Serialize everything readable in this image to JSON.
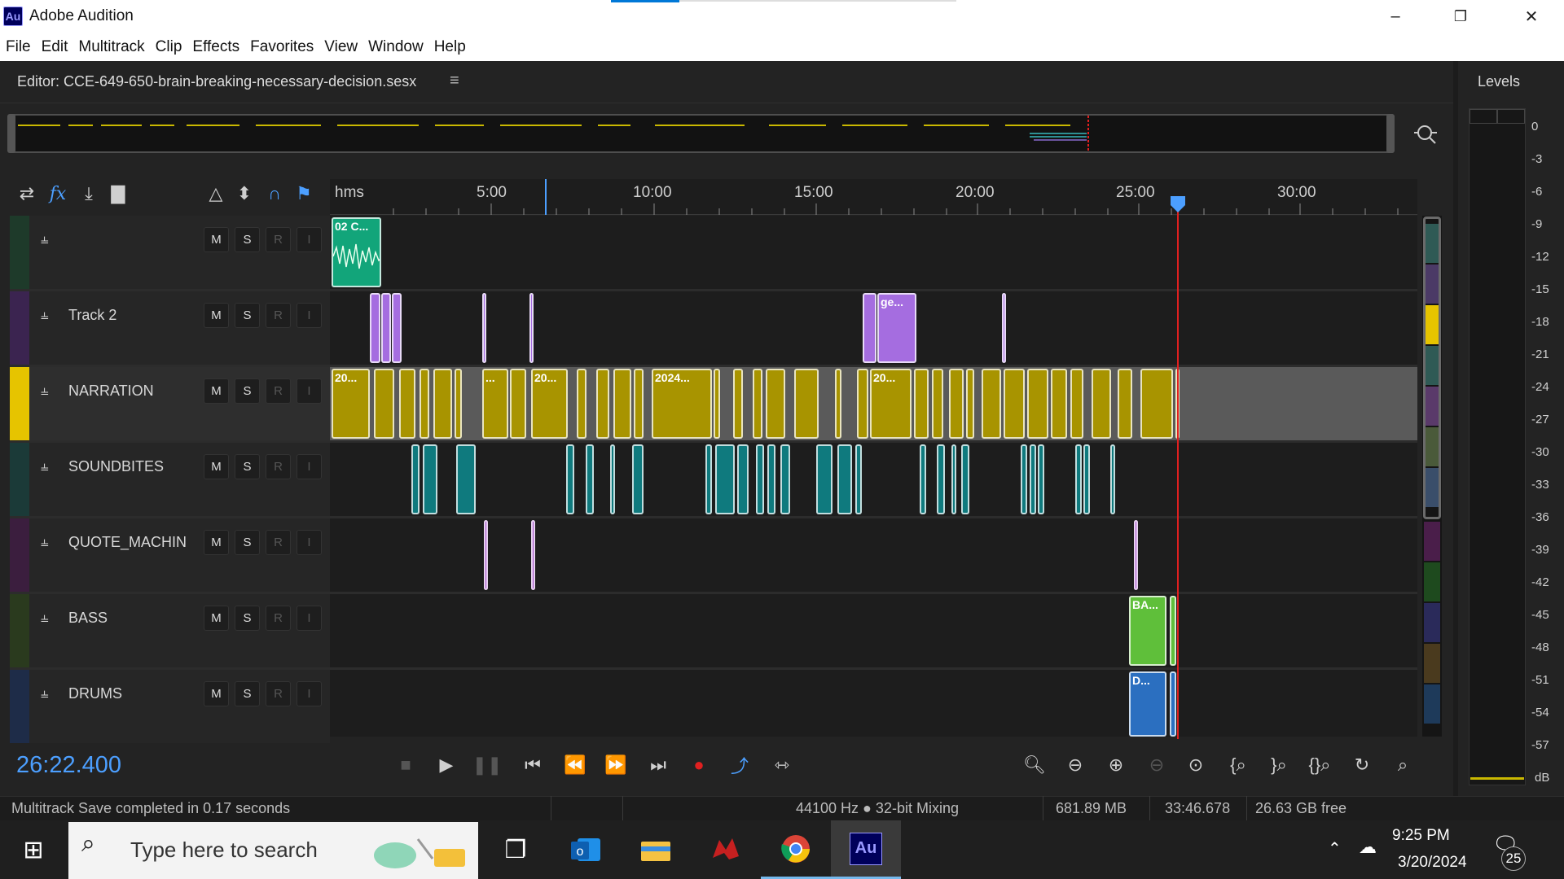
{
  "window": {
    "app_icon": "Au",
    "title": "Adobe Audition",
    "controls": [
      "minimize-icon",
      "restore-icon",
      "close-icon"
    ]
  },
  "menu": [
    "File",
    "Edit",
    "Multitrack",
    "Clip",
    "Effects",
    "Favorites",
    "View",
    "Window",
    "Help"
  ],
  "editor": {
    "tab": "Editor: CCE-649-650-brain-breaking-necessary-decision.sesx",
    "menu_icon": "≡"
  },
  "ruler": {
    "unit": "hms",
    "ticks": [
      "5:00",
      "10:00",
      "15:00",
      "20:00",
      "25:00",
      "30:00"
    ]
  },
  "tracks": [
    {
      "name": "",
      "color": "#1e3a2a",
      "buttons": [
        "M",
        "S",
        "R",
        "I"
      ],
      "clip_color": "#12a57a",
      "clip_labels": [
        "02 C..."
      ]
    },
    {
      "name": "Track 2",
      "color": "#3b2450",
      "buttons": [
        "M",
        "S",
        "R",
        "I"
      ],
      "clip_color": "#a56de0",
      "clip_labels": [
        "ge..."
      ]
    },
    {
      "name": "NARRATION",
      "color": "#e6c400",
      "buttons": [
        "M",
        "S",
        "R",
        "I"
      ],
      "clip_color": "#a89400",
      "clip_labels": [
        "20...",
        "...",
        "20...",
        "2024...",
        "20..."
      ]
    },
    {
      "name": "SOUNDBITES",
      "color": "#1b3a38",
      "buttons": [
        "M",
        "S",
        "R",
        "I"
      ],
      "clip_color": "#0f7a7e",
      "clip_labels": []
    },
    {
      "name": "QUOTE_MACHIN",
      "color": "#3b1e3e",
      "buttons": [
        "M",
        "S",
        "R",
        "I"
      ],
      "clip_color": "#a24ec8",
      "clip_labels": []
    },
    {
      "name": "BASS",
      "color": "#2a3a1e",
      "buttons": [
        "M",
        "S",
        "R",
        "I"
      ],
      "clip_color": "#5fbf3a",
      "clip_labels": [
        "BA..."
      ]
    },
    {
      "name": "DRUMS",
      "color": "#1e2c48",
      "buttons": [
        "M",
        "S",
        "R",
        "I"
      ],
      "clip_color": "#2b6fc0",
      "clip_labels": [
        "D..."
      ]
    }
  ],
  "transport": {
    "time": "26:22.400",
    "buttons": [
      "stop-icon",
      "play-icon",
      "pause-icon",
      "go-to-start-icon",
      "rewind-icon",
      "fast-forward-icon",
      "go-to-end-icon",
      "record-icon",
      "loop-icon",
      "skip-selection-icon"
    ]
  },
  "zoom_tools": [
    "zoom-in-amplitude-icon",
    "zoom-out-amplitude-icon",
    "zoom-in-time-icon",
    "zoom-out-time-icon",
    "zoom-out-full-icon",
    "zoom-in-at-start-icon",
    "zoom-in-at-end-icon",
    "zoom-selection-icon",
    "zoom-to-tracks-icon",
    "zoom-tracks-icon"
  ],
  "levels": {
    "title": "Levels",
    "scale": [
      "0",
      "-3",
      "-6",
      "-9",
      "-12",
      "-15",
      "-18",
      "-21",
      "-24",
      "-27",
      "-30",
      "-33",
      "-36",
      "-39",
      "-42",
      "-45",
      "-48",
      "-51",
      "-54",
      "-57",
      "dB"
    ]
  },
  "status": {
    "message": "Multitrack Save completed in 0.17 seconds",
    "sample_rate": "44100 Hz ● 32-bit Mixing",
    "memory": "681.89 MB",
    "duration": "33:46.678",
    "free_space": "26.63 GB free"
  },
  "taskbar": {
    "search_placeholder": "Type here to search",
    "time": "9:25 PM",
    "date": "3/20/2024",
    "notifications": "25",
    "apps": [
      "task-view-icon",
      "outlook-icon",
      "file-explorer-icon",
      "red-app-icon",
      "chrome-icon",
      "audition-icon"
    ]
  }
}
